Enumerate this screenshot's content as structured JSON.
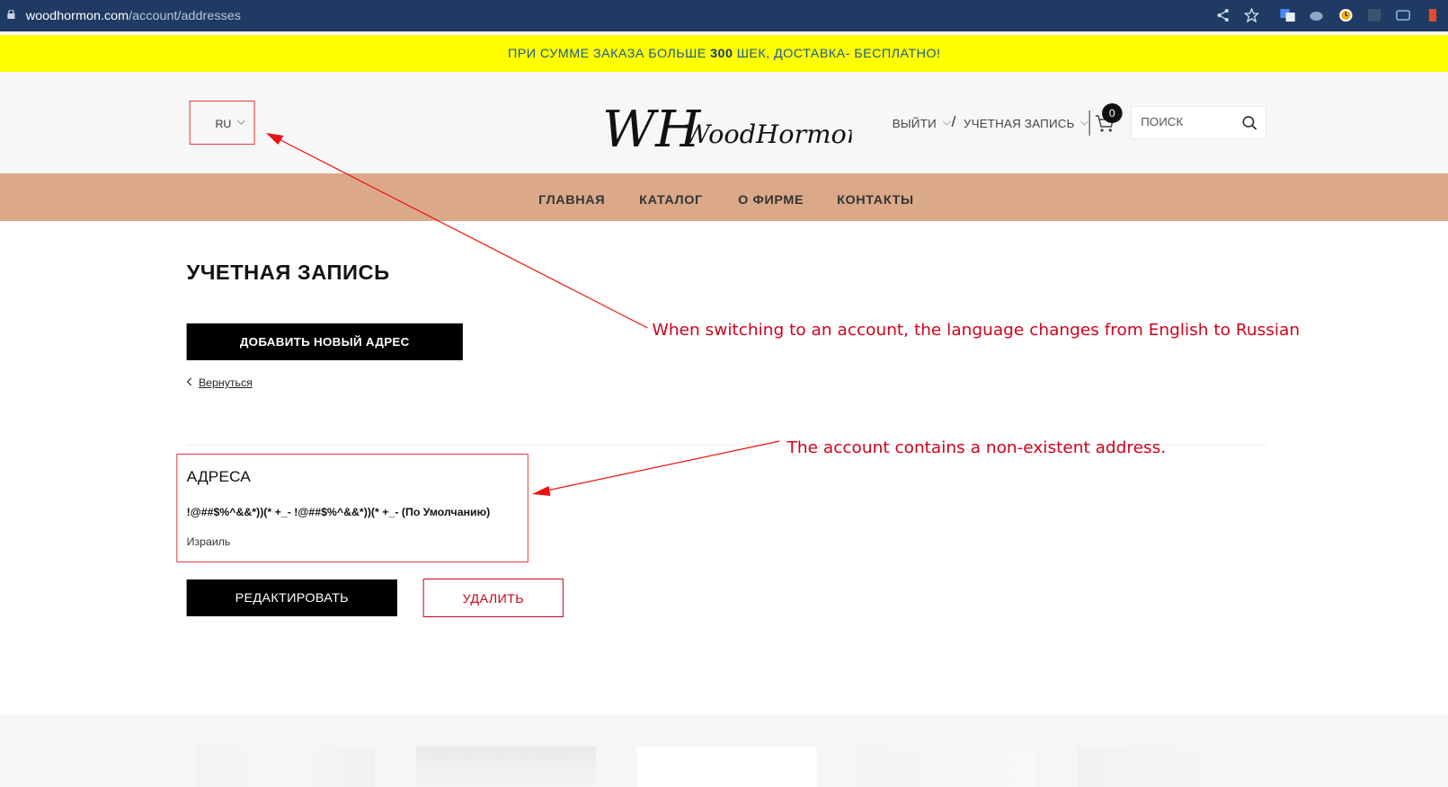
{
  "browser": {
    "url_host": "woodhormon.com",
    "url_path": "/account/addresses"
  },
  "promo": {
    "text_before": "ПРИ СУММЕ ЗАКАЗА БОЛЬШЕ ",
    "amount": "300",
    "text_after": " ШЕК, ДОСТАВКА- БЕСПЛАТНО!"
  },
  "header": {
    "language": "RU",
    "logout_label": "ВЫЙТИ",
    "separator": "/",
    "account_label": "УЧЕТНАЯ ЗАПИСЬ",
    "cart_count": "0",
    "search_placeholder": "ПОИСК",
    "logo_text": "WoodHormon",
    "logo_monogram": "WH"
  },
  "nav": {
    "items": [
      "ГЛАВНАЯ",
      "КАТАЛОГ",
      "О ФИРМЕ",
      "КОНТАКТЫ"
    ]
  },
  "content": {
    "title": "УЧЕТНАЯ ЗАПИСЬ",
    "add_address_button": "ДОБАВИТЬ НОВЫЙ АДРЕС",
    "back_link": "Вернуться",
    "addresses_heading": "АДРЕСА",
    "address_name": "!@##$%^&&*))(* +_- !@##$%^&&*))(* +_- (По Умолчанию)",
    "address_country": "Израиль",
    "edit_button": "РЕДАКТИРОВАТЬ",
    "delete_button": "УДАЛИТЬ"
  },
  "annotations": {
    "language_note": "When switching to an account, the language changes from English to Russian",
    "address_note": "The account contains a non-existent address."
  },
  "colors": {
    "browser_bar": "#1f3a63",
    "promo_bg": "#ffff00",
    "nav_bg": "#dba98a",
    "annotation_red": "#d0021b"
  }
}
